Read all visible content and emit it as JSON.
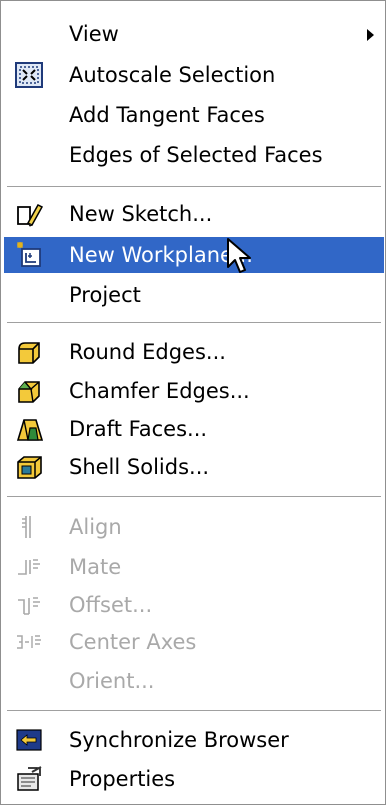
{
  "menu": {
    "items": [
      {
        "label": "View",
        "icon": "",
        "has_submenu": true
      },
      {
        "label": "Autoscale Selection",
        "icon": "autoscale-icon"
      },
      {
        "label": "Add Tangent Faces",
        "icon": ""
      },
      {
        "label": "Edges of Selected Faces",
        "icon": ""
      },
      {
        "label": "New Sketch...",
        "icon": "new-sketch-icon"
      },
      {
        "label": "New Workplane...",
        "icon": "new-workplane-icon",
        "highlighted": true
      },
      {
        "label": "Project",
        "icon": ""
      },
      {
        "label": "Round Edges...",
        "icon": "round-edges-icon"
      },
      {
        "label": "Chamfer Edges...",
        "icon": "chamfer-edges-icon"
      },
      {
        "label": "Draft Faces...",
        "icon": "draft-faces-icon"
      },
      {
        "label": "Shell Solids...",
        "icon": "shell-solids-icon"
      },
      {
        "label": "Align",
        "icon": "align-icon",
        "disabled": true
      },
      {
        "label": "Mate",
        "icon": "mate-icon",
        "disabled": true
      },
      {
        "label": "Offset...",
        "icon": "offset-icon",
        "disabled": true
      },
      {
        "label": "Center Axes",
        "icon": "center-axes-icon",
        "disabled": true
      },
      {
        "label": "Orient...",
        "icon": "",
        "disabled": true
      },
      {
        "label": "Synchronize Browser",
        "icon": "synchronize-browser-icon"
      },
      {
        "label": "Properties",
        "icon": "properties-icon"
      }
    ]
  },
  "colors": {
    "highlight": "#3167c7",
    "disabled_text": "#a9a9a9",
    "separator": "#a0a0a0"
  }
}
